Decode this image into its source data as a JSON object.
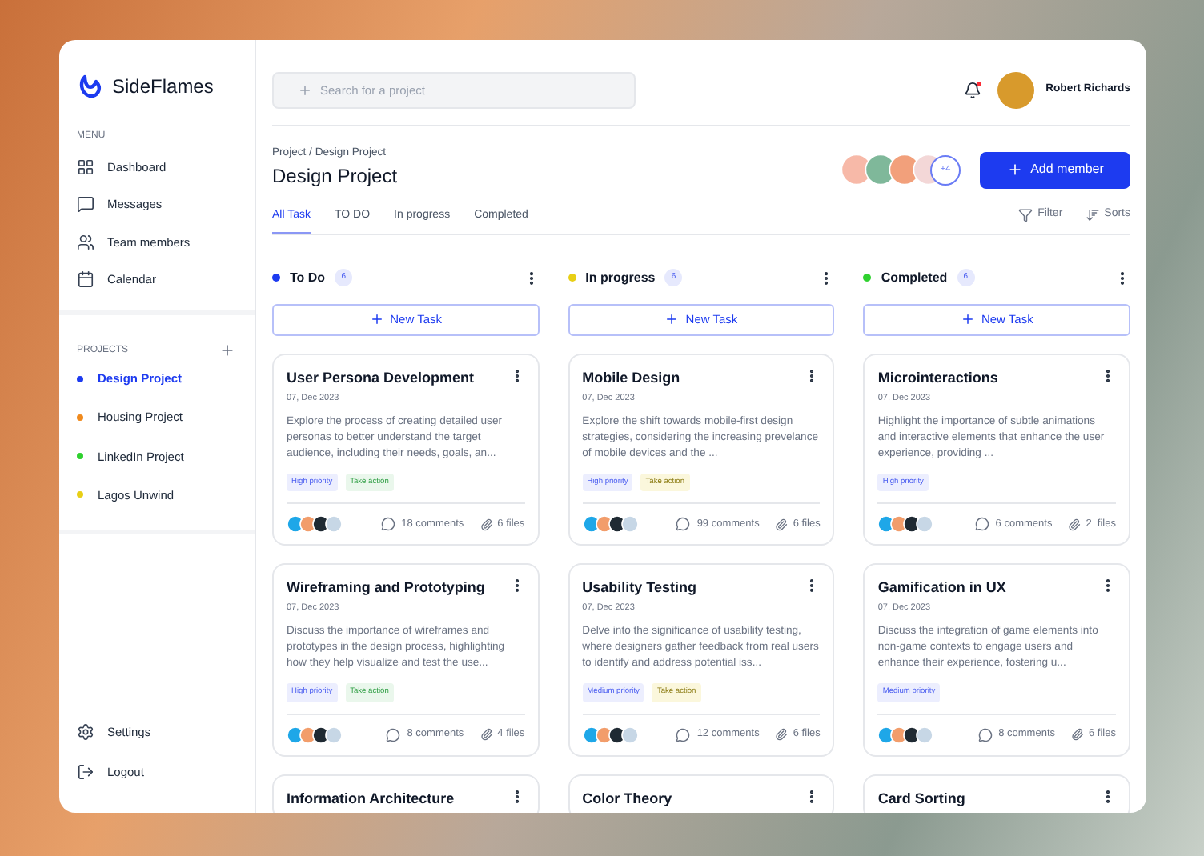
{
  "brand": {
    "name": "SideFlames"
  },
  "sidebar": {
    "menu_heading": "MENU",
    "menu": [
      {
        "label": "Dashboard",
        "selected": false
      },
      {
        "label": "Messages",
        "selected": false
      },
      {
        "label": "Team members",
        "selected": false
      },
      {
        "label": "Calendar",
        "selected": false
      }
    ],
    "projects_heading": "PROJECTS",
    "projects": [
      {
        "label": "Design Project",
        "color": "#1d3bf0",
        "selected": true
      },
      {
        "label": "Housing Project",
        "color": "#f08a1d",
        "selected": false
      },
      {
        "label": "LinkedIn Project",
        "color": "#2fd12f",
        "selected": false
      },
      {
        "label": "Lagos Unwind",
        "color": "#e8cf16",
        "selected": false
      }
    ],
    "bottom": [
      {
        "label": "Settings"
      },
      {
        "label": "Logout"
      }
    ]
  },
  "search": {
    "placeholder": "Search for a project"
  },
  "user": {
    "name": "Robert Richards",
    "has_notification": true
  },
  "breadcrumb": "Project / Design Project",
  "title": "Design Project",
  "members": {
    "more": "+4"
  },
  "add_member": "Add member",
  "tabs": [
    {
      "label": "All Task",
      "selected": true
    },
    {
      "label": "TO DO",
      "selected": false
    },
    {
      "label": "In progress",
      "selected": false
    },
    {
      "label": "Completed",
      "selected": false
    }
  ],
  "filter": "Filter",
  "sorts": "Sorts",
  "columns": [
    {
      "name": "To Do",
      "color": "#1d3bf0",
      "count": "6",
      "new_task": "New Task",
      "cards": [
        {
          "title": "User Persona Development",
          "date": "07, Dec 2023",
          "description": "Explore the process of creating detailed user personas to better understand the target audience, including their needs, goals, an...",
          "tags": [
            {
              "label": "High priority",
              "color": "#eceefe"
            },
            {
              "label": "Take action",
              "color": "#eaf7ec"
            }
          ],
          "comments": "18 comments",
          "files": "6 files"
        },
        {
          "title": "Wireframing and Prototyping",
          "date": "07, Dec 2023",
          "description": "Discuss the importance of wireframes and prototypes in the design process, highlighting how they help visualize and test the use...",
          "tags": [
            {
              "label": "High priority",
              "color": "#eceefe"
            },
            {
              "label": "Take action",
              "color": "#eaf7ec"
            }
          ],
          "comments": "8 comments",
          "files": "4 files"
        },
        {
          "title": "Information Architecture"
        }
      ]
    },
    {
      "name": "In progress",
      "color": "#e8cf16",
      "count": "6",
      "new_task": "New Task",
      "cards": [
        {
          "title": "Mobile Design",
          "date": "07, Dec 2023",
          "description": "Explore the shift towards mobile-first design strategies, considering the increasing prevelance of mobile devices and the ...",
          "tags": [
            {
              "label": "High priority",
              "color": "#eceefe"
            },
            {
              "label": "Take action",
              "color": "#fbf7dc"
            }
          ],
          "comments": "99 comments",
          "files": "6 files"
        },
        {
          "title": "Usability Testing",
          "date": "07, Dec 2023",
          "description": "Delve into the significance of usability testing, where designers gather feedback from real users to identify and address potential iss...",
          "tags": [
            {
              "label": "Medium priority",
              "color": "#eceefe"
            },
            {
              "label": "Take action",
              "color": "#fbf7dc"
            }
          ],
          "comments": "12 comments",
          "files": "6 files"
        },
        {
          "title": "Color Theory"
        }
      ]
    },
    {
      "name": "Completed",
      "color": "#2fd12f",
      "count": "6",
      "new_task": "New Task",
      "cards": [
        {
          "title": "Microinteractions",
          "date": "07, Dec 2023",
          "description": "Highlight the importance of subtle animations and interactive elements that enhance the user experience, providing ...",
          "tags": [
            {
              "label": "High priority",
              "color": "#eceefe"
            }
          ],
          "comments": "6 comments",
          "files": "2  files"
        },
        {
          "title": "Gamification in UX",
          "date": "07, Dec 2023",
          "description": "Discuss the integration of game elements into non-game contexts to engage users and enhance their experience, fostering u...",
          "tags": [
            {
              "label": "Medium priority",
              "color": "#eceefe"
            }
          ],
          "comments": "8 comments",
          "files": "6 files"
        },
        {
          "title": "Card Sorting"
        }
      ]
    }
  ]
}
